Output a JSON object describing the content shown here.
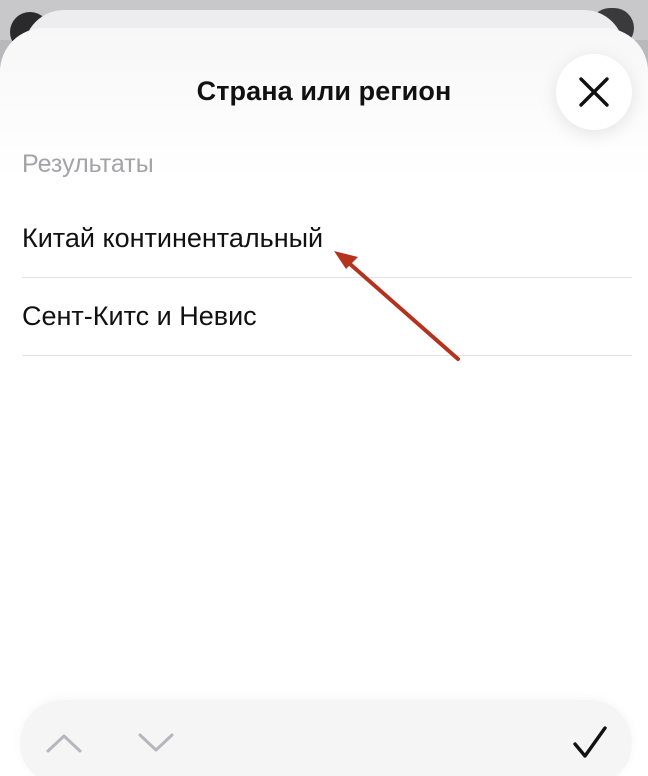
{
  "sheet": {
    "title": "Страна или регион",
    "close_icon": "close-icon"
  },
  "results": {
    "label": "Результаты",
    "items": [
      {
        "label": "Китай континентальный"
      },
      {
        "label": "Сент-Китс и Невис"
      }
    ]
  },
  "annotation": {
    "type": "arrow",
    "color": "#b5321e",
    "points_to": "Китай континентальный"
  },
  "toolbar": {
    "prev_icon": "chevron-up-icon",
    "next_icon": "chevron-down-icon",
    "done_icon": "checkmark-icon"
  }
}
